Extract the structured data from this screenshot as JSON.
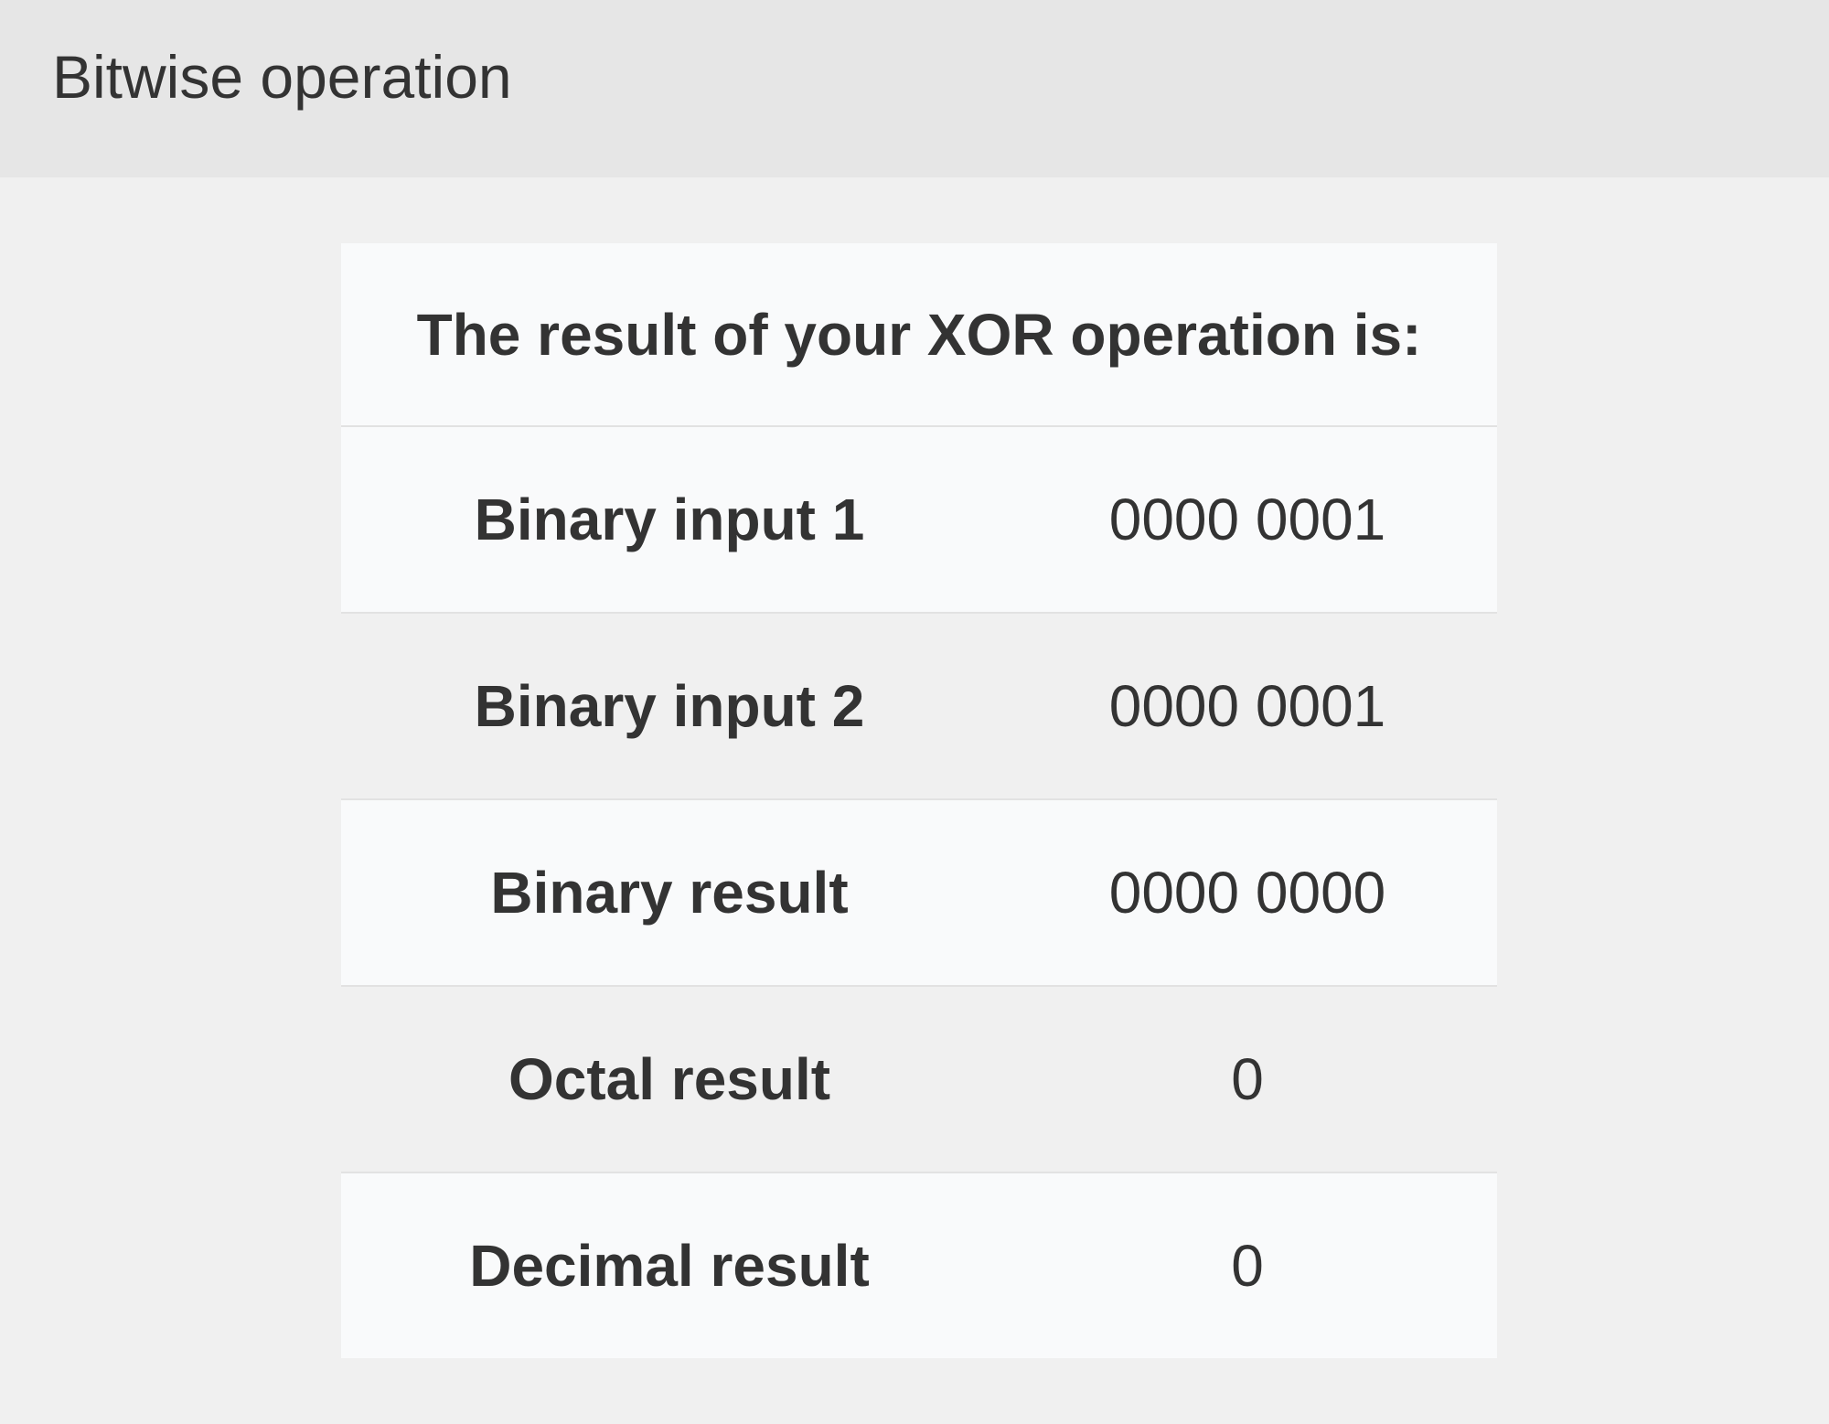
{
  "header": {
    "title": "Bitwise operation"
  },
  "result": {
    "caption": "The result of your XOR operation is:",
    "rows": [
      {
        "label": "Binary input 1",
        "value": "0000 0001"
      },
      {
        "label": "Binary input 2",
        "value": "0000 0001"
      },
      {
        "label": "Binary result",
        "value": "0000 0000"
      },
      {
        "label": "Octal result",
        "value": "0"
      },
      {
        "label": "Decimal result",
        "value": "0"
      }
    ]
  }
}
